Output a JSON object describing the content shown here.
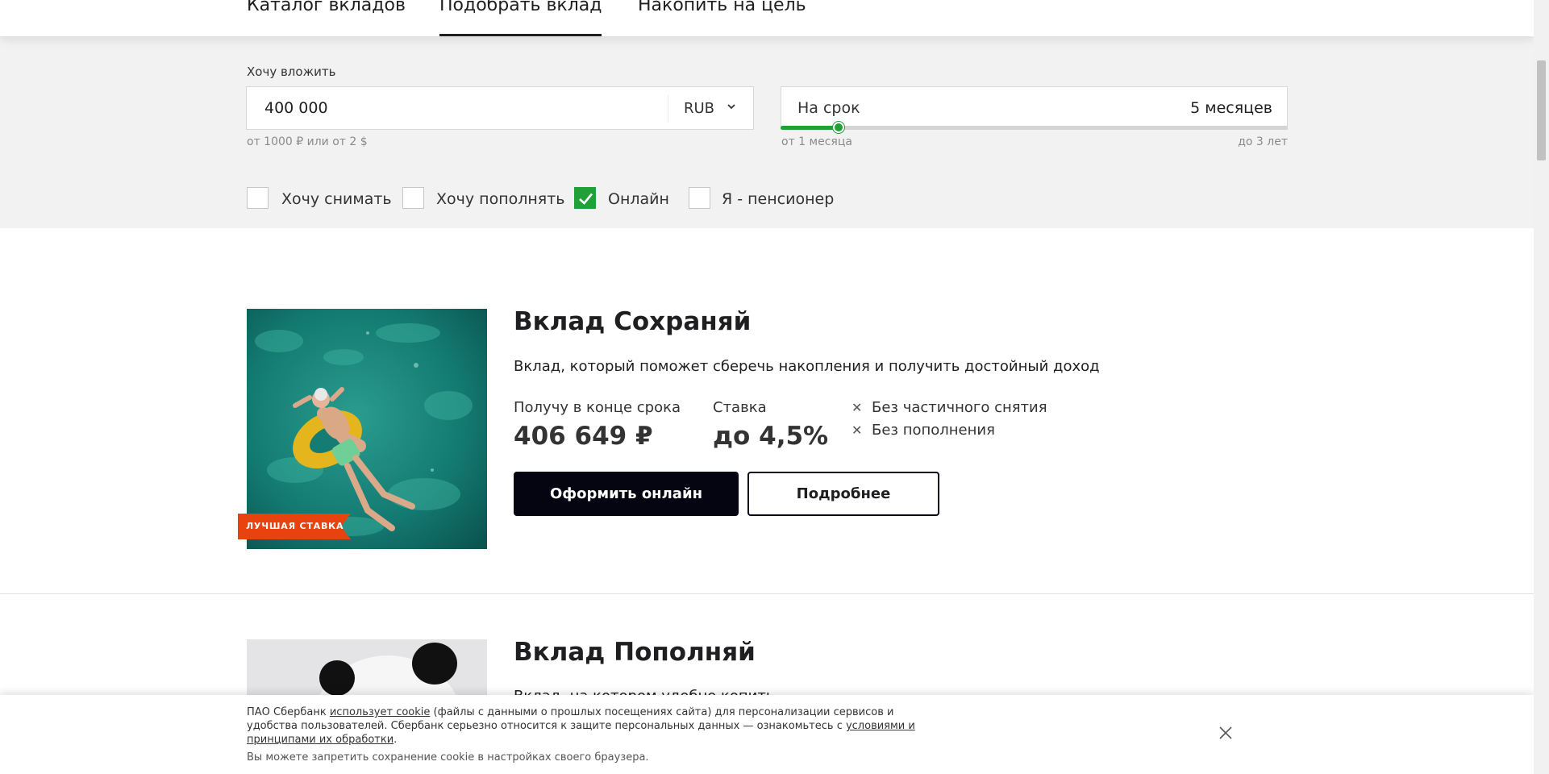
{
  "tabs": [
    {
      "label": "Каталог вкладов",
      "active": false
    },
    {
      "label": "Подобрать вклад",
      "active": true
    },
    {
      "label": "Накопить на цель",
      "active": false
    }
  ],
  "filters": {
    "invest_label": "Хочу вложить",
    "amount": "400 000",
    "currency": "RUB",
    "amount_hint": "от 1000 ₽ или от 2 $",
    "term_label": "На срок",
    "term_value": "5 месяцев",
    "term_min": "от 1 месяца",
    "term_max": "до 3 лет",
    "term_slider_fraction": 0.115,
    "checkboxes": [
      {
        "label": "Хочу снимать",
        "checked": false
      },
      {
        "label": "Хочу пополнять",
        "checked": false
      },
      {
        "label": "Онлайн",
        "checked": true
      },
      {
        "label": "Я - пенсионер",
        "checked": false
      }
    ]
  },
  "products": [
    {
      "title": "Вклад Сохраняй",
      "description": "Вклад, который поможет сберечь накопления и получить достойный доход",
      "ribbon": "ЛУЧШАЯ СТАВКА",
      "get_label": "Получу в конце срока",
      "get_value": "406 649 ₽",
      "rate_label": "Ставка",
      "rate_value": "до 4,5%",
      "conditions": [
        "Без частичного снятия",
        "Без пополнения"
      ],
      "primary_button": "Оформить онлайн",
      "secondary_button": "Подробнее"
    },
    {
      "title": "Вклад Пополняй",
      "description": "Вклад, на котором удобно копить"
    }
  ],
  "cookie": {
    "t1": "ПАО Сбербанк ",
    "link1": "использует cookie",
    "t2": " (файлы с данными о прошлых посещениях сайта) для персонализации сервисов и удобства пользователей. Сбербанк серьезно относится к защите персональных данных — ознакомьтесь с ",
    "link2": "условиями и принципами их обработки",
    "t3": ".",
    "note": "Вы можете запретить сохранение cookie в настройках своего браузера."
  },
  "colors": {
    "accent_green": "#21a038",
    "button_dark": "#050511",
    "ribbon_orange": "#e8430f"
  },
  "icons": {
    "currency_dropdown": "chevron-down-icon",
    "checkbox_checked": "check-icon",
    "condition": "cross-icon",
    "cookie_close": "close-icon"
  }
}
